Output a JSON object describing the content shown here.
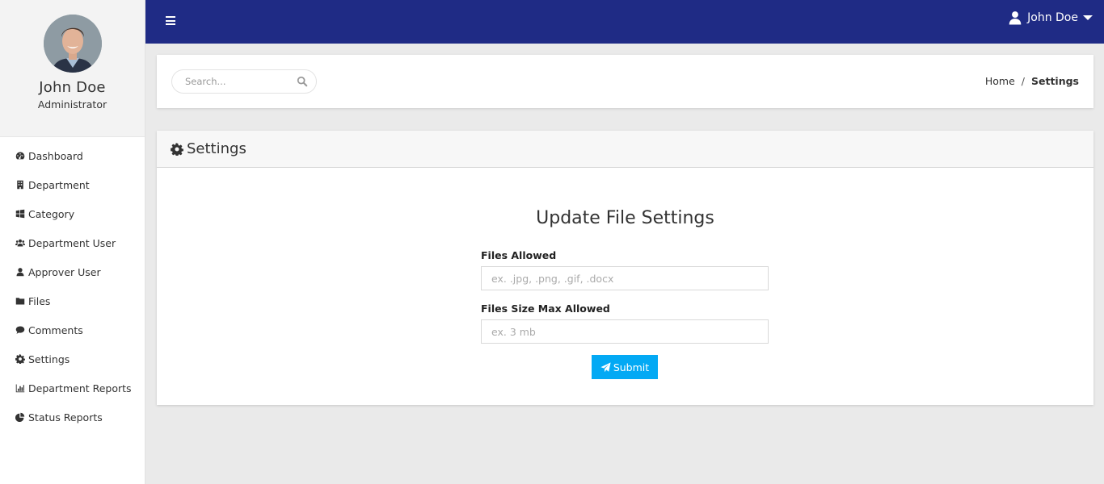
{
  "profile": {
    "name": "John Doe",
    "role": "Administrator",
    "avatar_icon": "user-photo"
  },
  "sidebar": {
    "items": [
      {
        "label": "Dashboard",
        "icon": "dashboard-icon"
      },
      {
        "label": "Department",
        "icon": "building-icon"
      },
      {
        "label": "Category",
        "icon": "windows-icon"
      },
      {
        "label": "Department User",
        "icon": "users-icon"
      },
      {
        "label": "Approver User",
        "icon": "user-icon"
      },
      {
        "label": "Files",
        "icon": "folder-icon"
      },
      {
        "label": "Comments",
        "icon": "comment-icon"
      },
      {
        "label": "Settings",
        "icon": "gear-icon"
      },
      {
        "label": "Department Reports",
        "icon": "bar-chart-icon"
      },
      {
        "label": "Status Reports",
        "icon": "pie-chart-icon"
      }
    ]
  },
  "topbar": {
    "menu_icon": "hamburger-icon",
    "user_name": "John Doe",
    "brand_color": "#1f2b85"
  },
  "search": {
    "placeholder": "Search..."
  },
  "breadcrumb": {
    "home": "Home",
    "separator": "/",
    "current": "Settings"
  },
  "settings_card": {
    "title": "Settings",
    "form_title": "Update File Settings",
    "fields": [
      {
        "label": "Files Allowed",
        "placeholder": "ex. .jpg, .png, .gif, .docx",
        "value": ""
      },
      {
        "label": "Files Size Max Allowed",
        "placeholder": "ex. 3 mb",
        "value": ""
      }
    ],
    "submit_label": "Submit",
    "submit_color": "#03a9f4"
  }
}
